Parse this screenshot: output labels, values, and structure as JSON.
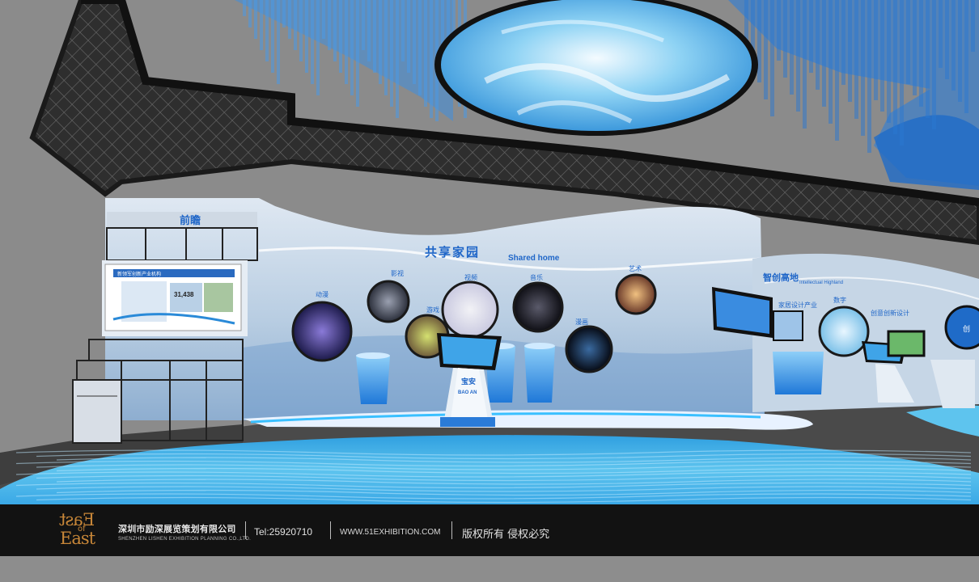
{
  "exhibit": {
    "zone_main_title": "共享家园",
    "zone_main_subtitle": "Shared home",
    "zone_right_title": "智创高地",
    "zone_right_subtitle": "Intellectual Highland",
    "left_panel_header": "前瞻",
    "screen_title": "新领军创新产业机构",
    "screen_value": "31,438",
    "circle_labels": [
      "动漫",
      "影视",
      "游戏",
      "漫画",
      "视频",
      "音乐",
      "艺术",
      "数字"
    ],
    "kiosk_label": "宝安",
    "kiosk_sublabel": "BAO AN",
    "design_label": "家居设计产业",
    "creative_label": "创意创新设计",
    "edge_label": "创"
  },
  "footer": {
    "logo_top": "East",
    "logo_of": "of",
    "logo_bottom": "East",
    "company_cn": "深圳市励深展览策划有限公司",
    "company_en": "SHENZHEN LISHEN EXHIBITION PLANNING CO.,LTD.",
    "tel": "Tel:25920710",
    "website": "WWW.51EXHIBITION.COM",
    "rights": "版权所有 侵权必究"
  },
  "colors": {
    "accent_blue": "#2a7bd8",
    "water": "#5ec4ee",
    "footer_bg": "#121212",
    "logo_gold": "#c78638"
  }
}
